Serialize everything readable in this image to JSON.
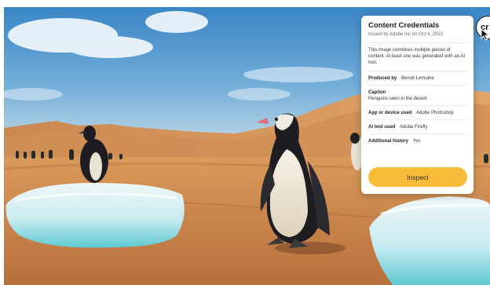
{
  "card": {
    "title": "Content Credentials",
    "issued": "Issued by Adobe Inc on Oct 4, 2023",
    "description": "This image combines multiple pieces of content. At least one was generated with an AI tool.",
    "produced_by_label": "Produced by",
    "produced_by_value": "Benoit Lemoine",
    "caption_label": "Caption",
    "caption_value": "Penguins seen in the desert.",
    "app_label": "App or device used",
    "app_value": "Adobe Photoshop",
    "ai_tool_label": "AI tool used",
    "ai_tool_value": "Adobe Firefly",
    "history_label": "Additional history",
    "history_value": "Yes",
    "inspect_label": "Inspect"
  },
  "badge": {
    "label": "cr",
    "icon": "content-credentials-icon"
  },
  "cursor": {
    "icon": "pointer-cursor-icon"
  },
  "image": {
    "subject": "penguins-in-desert-photo"
  }
}
